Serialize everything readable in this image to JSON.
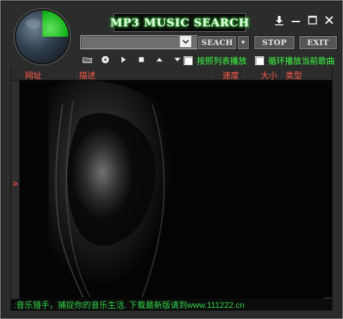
{
  "window": {
    "title": "MP3 MUSIC SEARCH",
    "buttons": {
      "download": "⬇",
      "minimize": "─",
      "maximize": "□",
      "close": "✕"
    }
  },
  "search": {
    "placeholder": "",
    "value": ""
  },
  "buttons": {
    "search": "SEACH",
    "search_option": "▾",
    "stop": "STOP",
    "exit": "EXIT"
  },
  "toggles": {
    "play_in_list_order": "按照列表播放",
    "loop_current": "循环播放当前歌曲"
  },
  "list": {
    "columns": [
      "网址",
      "描述",
      "速度",
      "大小",
      "类型"
    ],
    "left_arrow": ">",
    "right_arrow": "<"
  },
  "status": {
    "text": ":音乐猎手，捕捉你的音乐生活. 下载最新版请到www.111222.cn"
  },
  "colors": {
    "accent_green": "#3eff45",
    "header_red": "#ff5a49"
  }
}
